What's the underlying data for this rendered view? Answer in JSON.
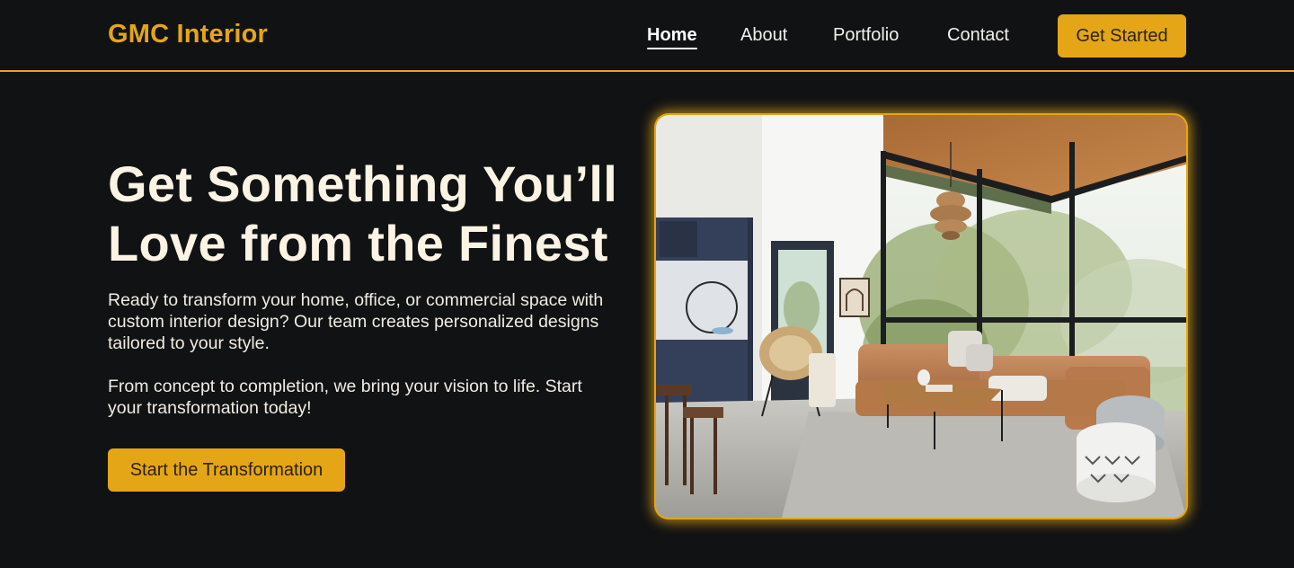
{
  "brand": {
    "name": "GMC Interior"
  },
  "nav": {
    "links": [
      {
        "label": "Home",
        "active": true
      },
      {
        "label": "About",
        "active": false
      },
      {
        "label": "Portfolio",
        "active": false
      },
      {
        "label": "Contact",
        "active": false
      }
    ],
    "cta_label": "Get Started"
  },
  "hero": {
    "title_line1": "Get Something You’ll",
    "title_line2": "Love from the Finest",
    "paragraph1": "Ready to transform your home, office, or commercial space with custom interior design? Our team creates personalized designs tailored to your style.",
    "paragraph2": "From concept to completion, we bring your vision to life. Start your transformation today!",
    "cta_label": "Start the Transformation"
  },
  "colors": {
    "background": "#111214",
    "accent": "#e4a617",
    "text": "#f3eee3"
  }
}
